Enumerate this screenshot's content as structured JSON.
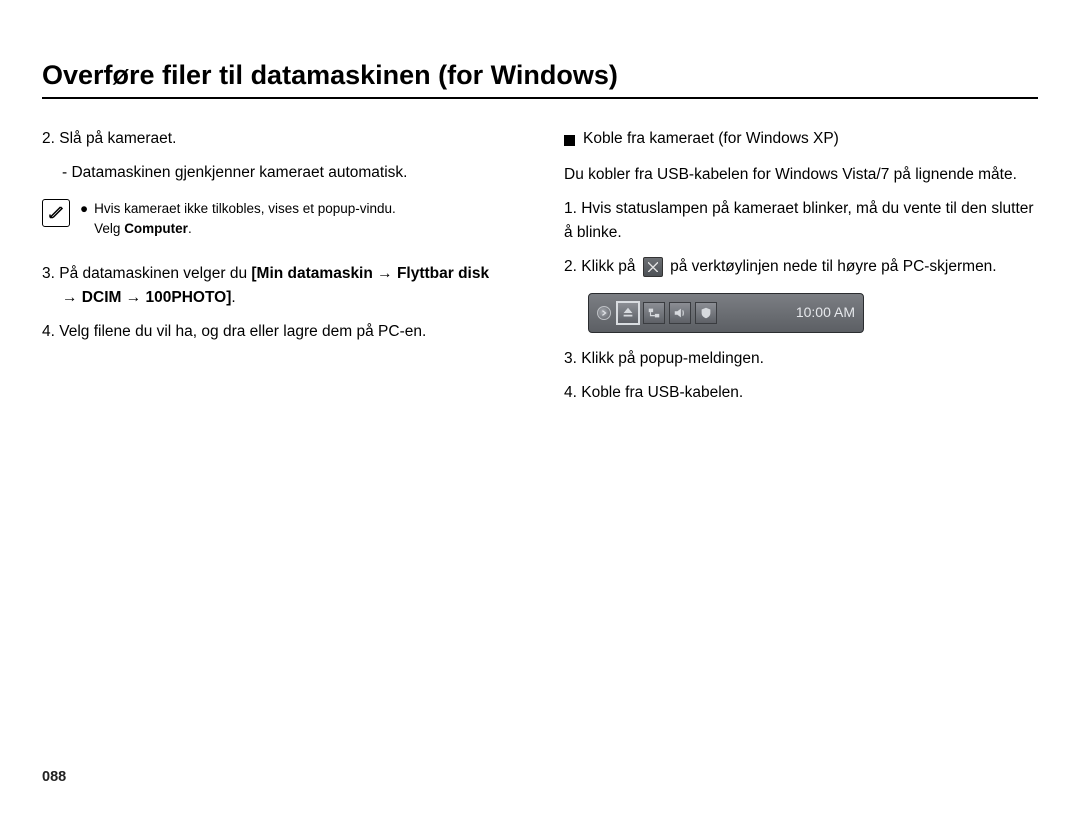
{
  "title": "Overføre filer til datamaskinen (for Windows)",
  "left": {
    "step2": "2. Slå på kameraet.",
    "step2_sub": "- Datamaskinen gjenkjenner kameraet automatisk.",
    "note_line1": "Hvis kameraet ikke tilkobles, vises et popup-vindu.",
    "note_line2_pre": "Velg ",
    "note_line2_bold": "Computer",
    "note_line2_post": ".",
    "step3_pre": "3. På datamaskinen velger du ",
    "step3_bold1": "[Min datamaskin → Flyttbar disk",
    "step3_bold2": "→ DCIM → 100PHOTO]",
    "step3_post": ".",
    "step4": "4. Velg filene du vil ha, og dra eller lagre dem på PC-en."
  },
  "right": {
    "heading": "Koble fra kameraet (for Windows XP)",
    "intro": "Du kobler fra USB-kabelen for Windows Vista/7 på lignende måte.",
    "step1": "1. Hvis statuslampen på kameraet blinker, må du vente til den slutter å blinke.",
    "step2_pre": "2. Klikk på ",
    "step2_post": " på verktøylinjen nede til høyre på PC-skjermen.",
    "tray_clock": "10:00 AM",
    "step3": "3. Klikk på popup-meldingen.",
    "step4": "4. Koble fra USB-kabelen."
  },
  "page_number": "088"
}
